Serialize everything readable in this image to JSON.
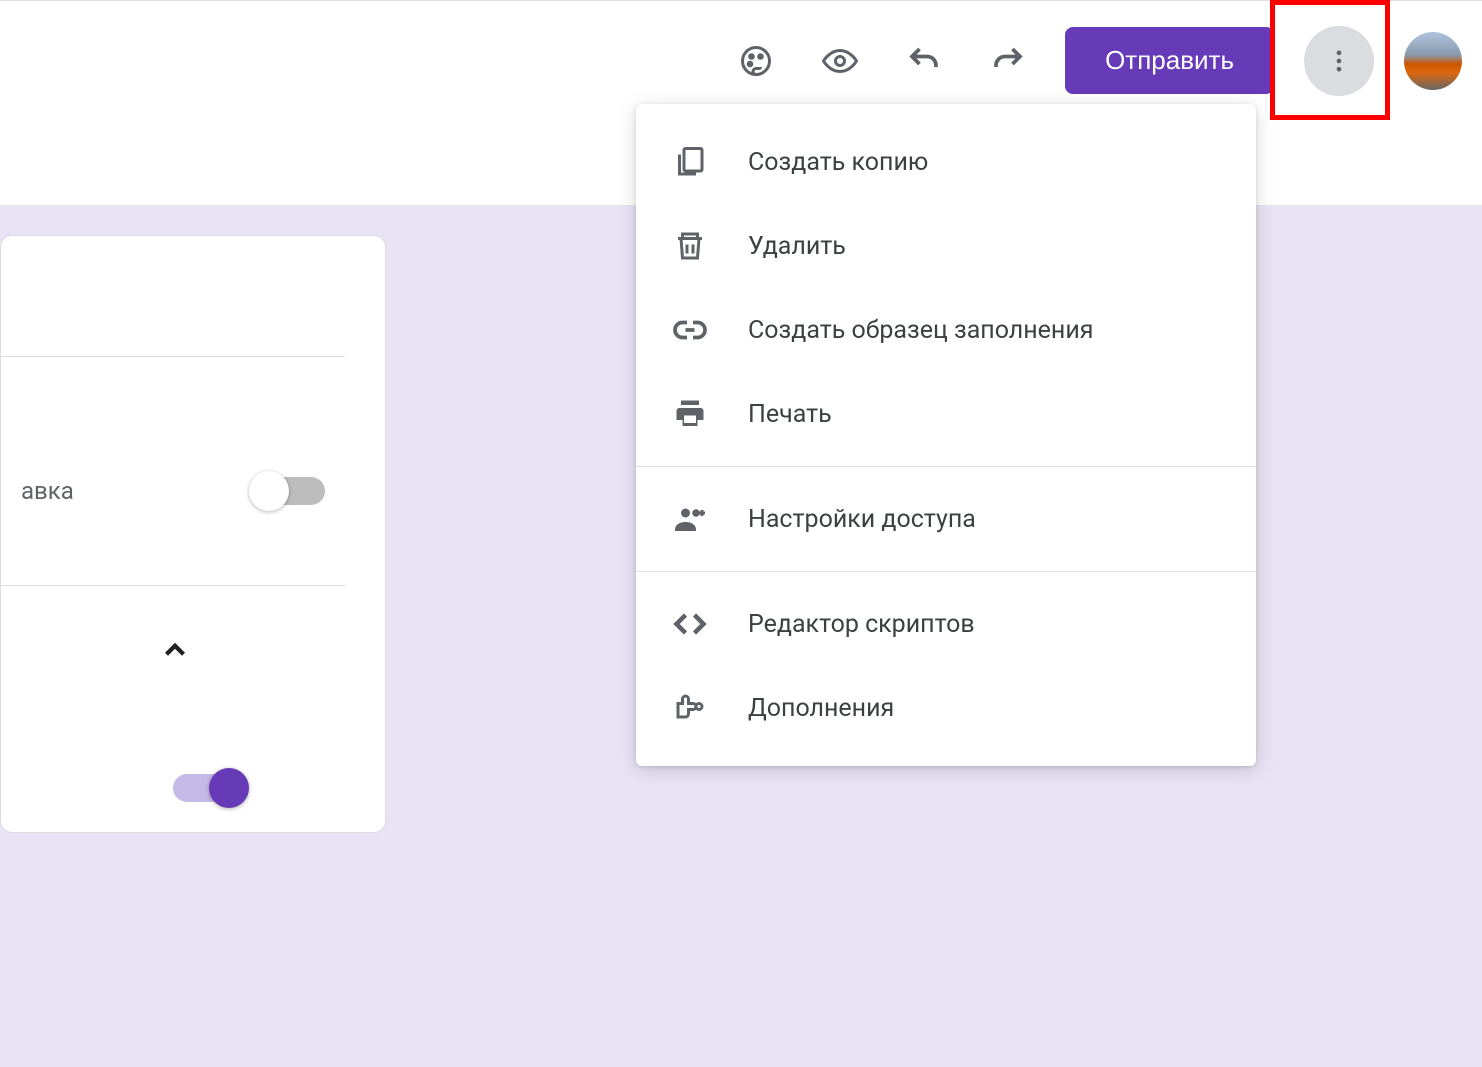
{
  "toolbar": {
    "send_label": "Отправить"
  },
  "panel": {
    "partial_label": "авка"
  },
  "menu": {
    "items": [
      {
        "icon": "copy-icon",
        "label": "Создать копию"
      },
      {
        "icon": "trash-icon",
        "label": "Удалить"
      },
      {
        "icon": "link-icon",
        "label": "Создать образец заполнения"
      },
      {
        "icon": "print-icon",
        "label": "Печать"
      }
    ],
    "items2": [
      {
        "icon": "person-add-icon",
        "label": "Настройки доступа"
      }
    ],
    "items3": [
      {
        "icon": "code-icon",
        "label": "Редактор скриптов"
      },
      {
        "icon": "puzzle-icon",
        "label": "Дополнения"
      }
    ]
  },
  "colors": {
    "accent": "#673ab7",
    "highlight": "#ff0000"
  }
}
